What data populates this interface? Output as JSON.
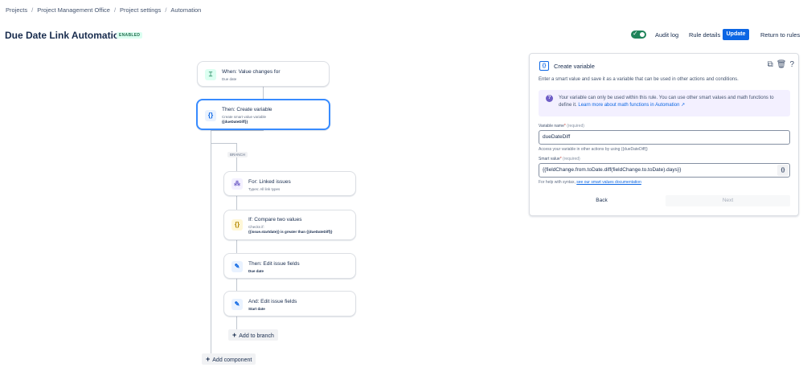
{
  "breadcrumb": [
    "Projects",
    "Project Management Office",
    "Project settings",
    "Automation"
  ],
  "header": {
    "title": "Due Date Link Automation",
    "status": "ENABLED",
    "audit_log": "Audit log",
    "rule_details": "Rule details",
    "update": "Update",
    "return": "Return to rules"
  },
  "flow": {
    "trigger": {
      "title": "When: Value changes for",
      "sub": "Due date"
    },
    "create_var": {
      "title": "Then: Create variable",
      "sub": "Create smart value variable",
      "sub2": "{{dueDateDiff}}"
    },
    "branch_label": "BRANCH",
    "linked": {
      "title": "For: Linked issues",
      "sub": "Types: All link types"
    },
    "compare": {
      "title": "If: Compare two values",
      "sub": "Checks if:",
      "sub2": "{{issue.startdate}} is greater than {{dueDateDiff}}"
    },
    "edit1": {
      "title": "Then: Edit issue fields",
      "sub2": "Due date"
    },
    "edit2": {
      "title": "And: Edit issue fields",
      "sub2": "Start date"
    },
    "add_to_branch": "Add to branch",
    "add_component": "Add component"
  },
  "panel": {
    "icon_text": "{}",
    "title": "Create variable",
    "desc": "Enter a smart value and save it as a variable that can be used in other actions and conditions.",
    "info_text": "Your variable can only be used within this rule. You can use other smart values and math functions to define it.",
    "info_link": "Learn more about math functions in Automation ↗",
    "var_label": "Variable name",
    "required_text": "(required)",
    "var_value": "dueDateDiff",
    "var_help": "Access your variable in other actions by using {{dueDateDiff}}",
    "smart_label": "Smart value",
    "smart_value": "{{fieldChange.from.toDate.diff(fieldChange.to.toDate).days}}",
    "smart_btn": "{}",
    "smart_help": "For help with syntax,",
    "smart_help_link": "see our smart values documentation",
    "back": "Back",
    "next": "Next"
  }
}
